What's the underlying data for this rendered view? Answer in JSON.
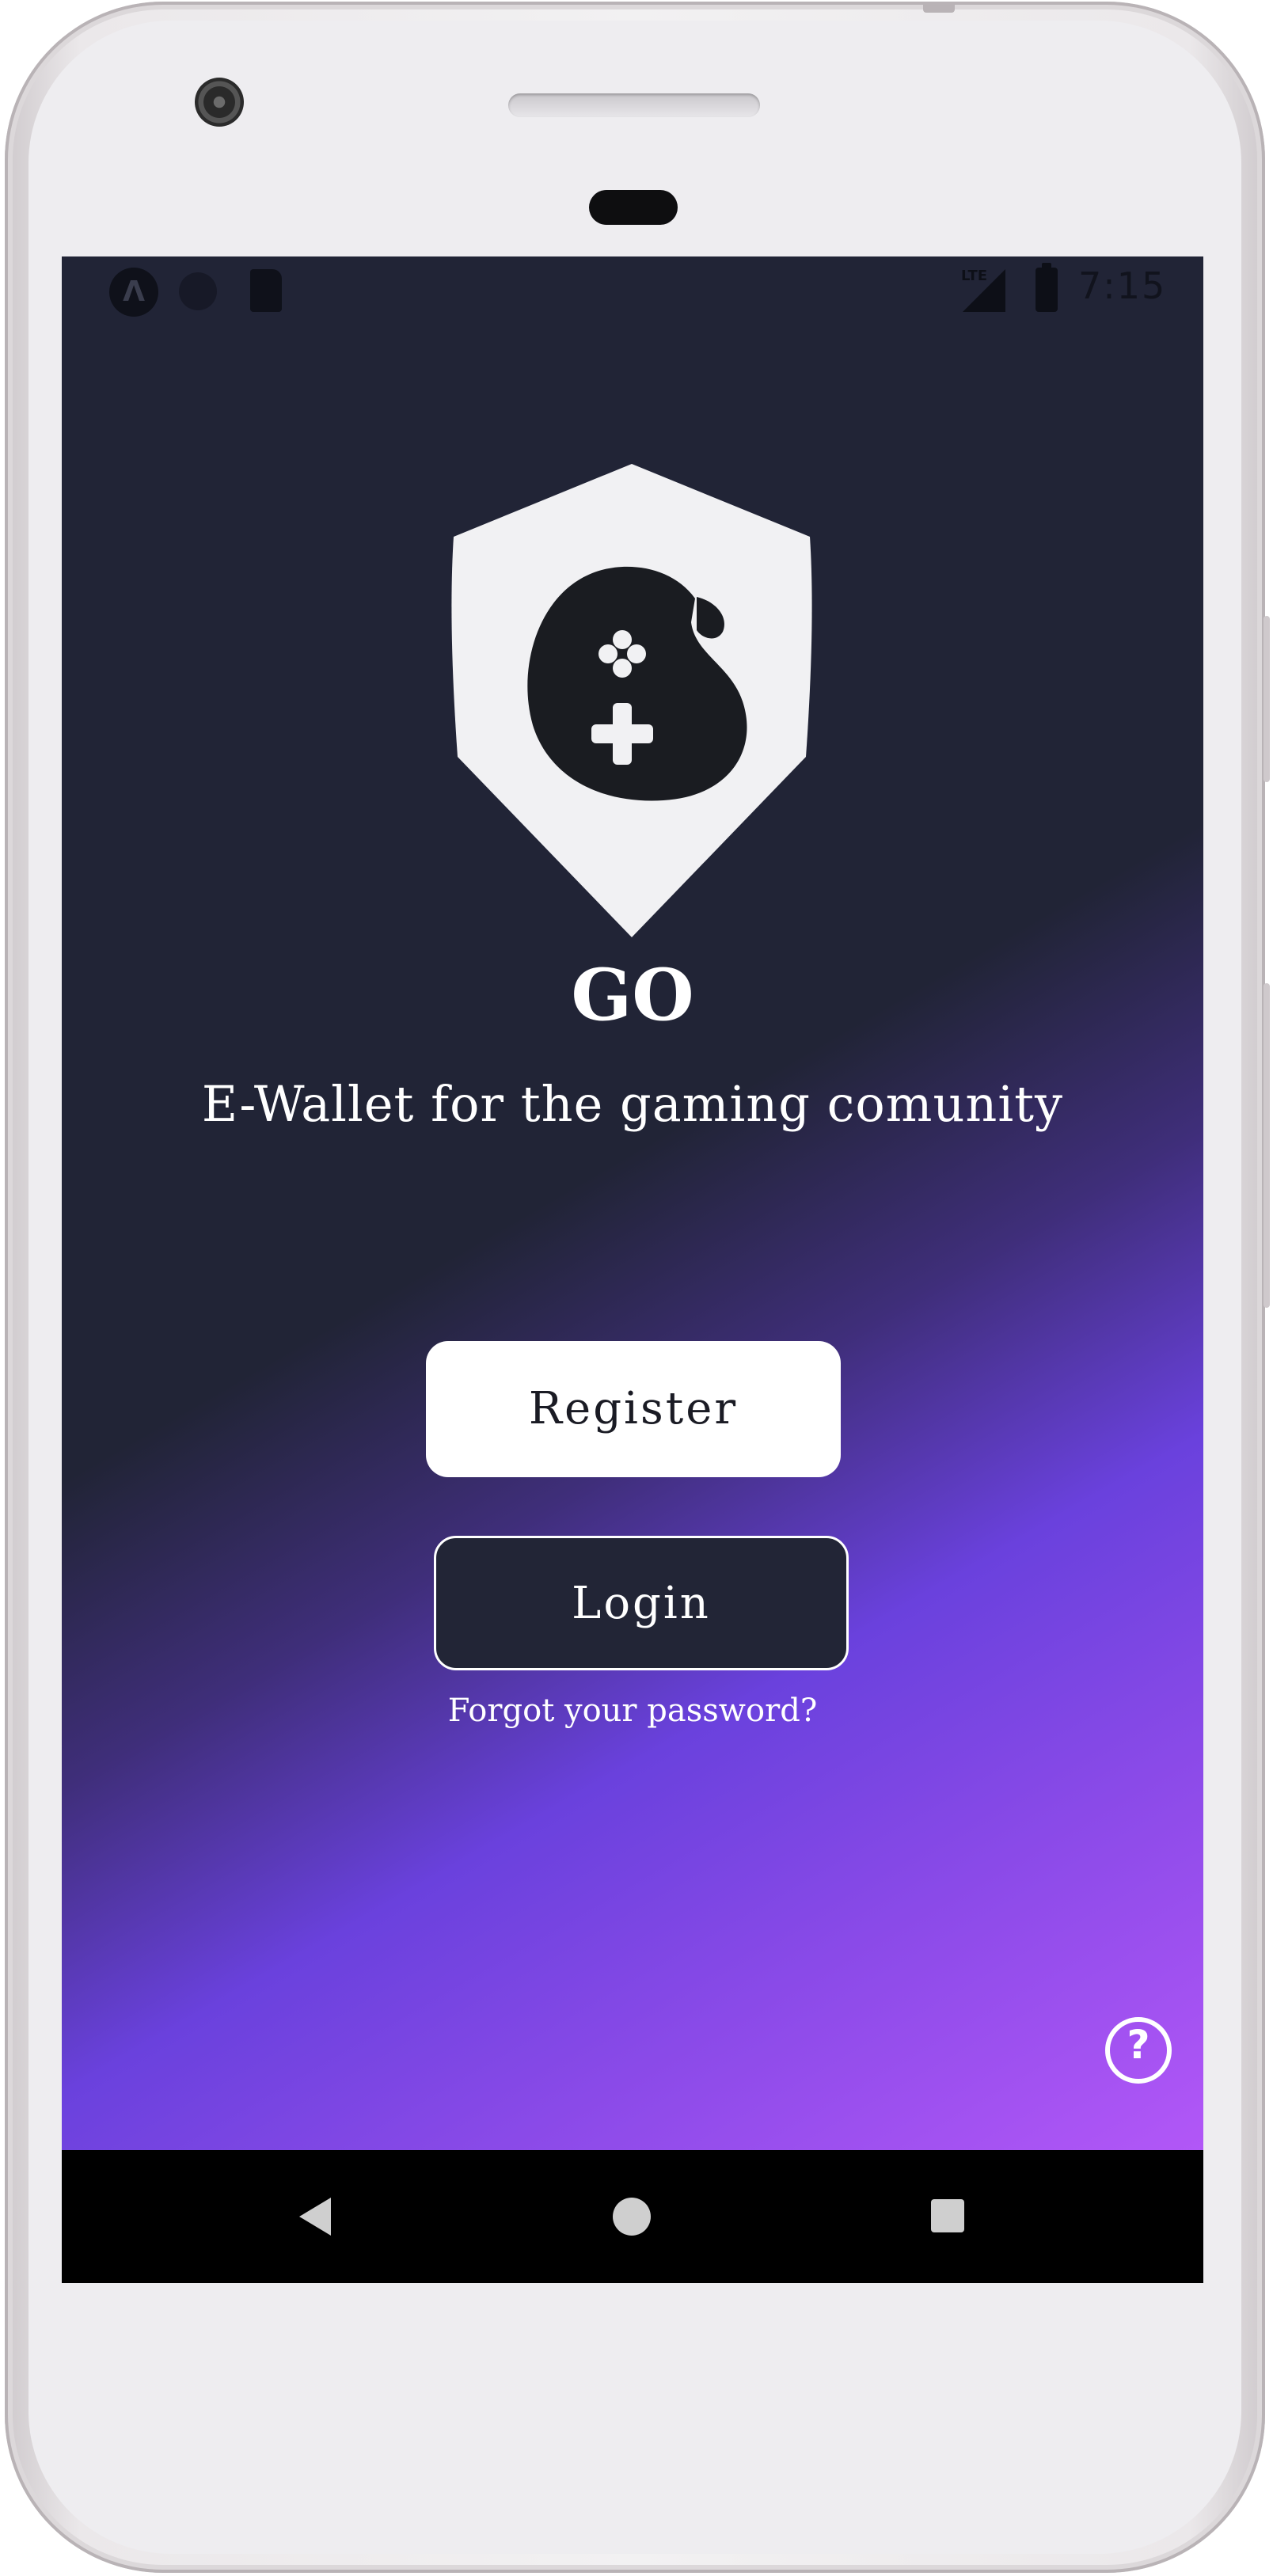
{
  "status_bar": {
    "time": "7:15",
    "network": "LTE",
    "icons": [
      "app-notification-icon",
      "circle-notification-icon",
      "sd-card-icon",
      "lte-signal-icon",
      "battery-icon"
    ]
  },
  "app": {
    "title": "GO",
    "subtitle": "E-Wallet for the gaming comunity",
    "register_label": "Register",
    "login_label": "Login",
    "forgot_label": "Forgot your password?",
    "help_label": "?"
  },
  "nav_bar": {
    "icons": [
      "back-icon",
      "home-icon",
      "recents-icon"
    ]
  },
  "colors": {
    "background_dark": "#212436",
    "gradient_purple": "#6a41dd",
    "gradient_pink": "#b257f7",
    "button_light": "#ffffff",
    "button_dark": "#222536"
  }
}
